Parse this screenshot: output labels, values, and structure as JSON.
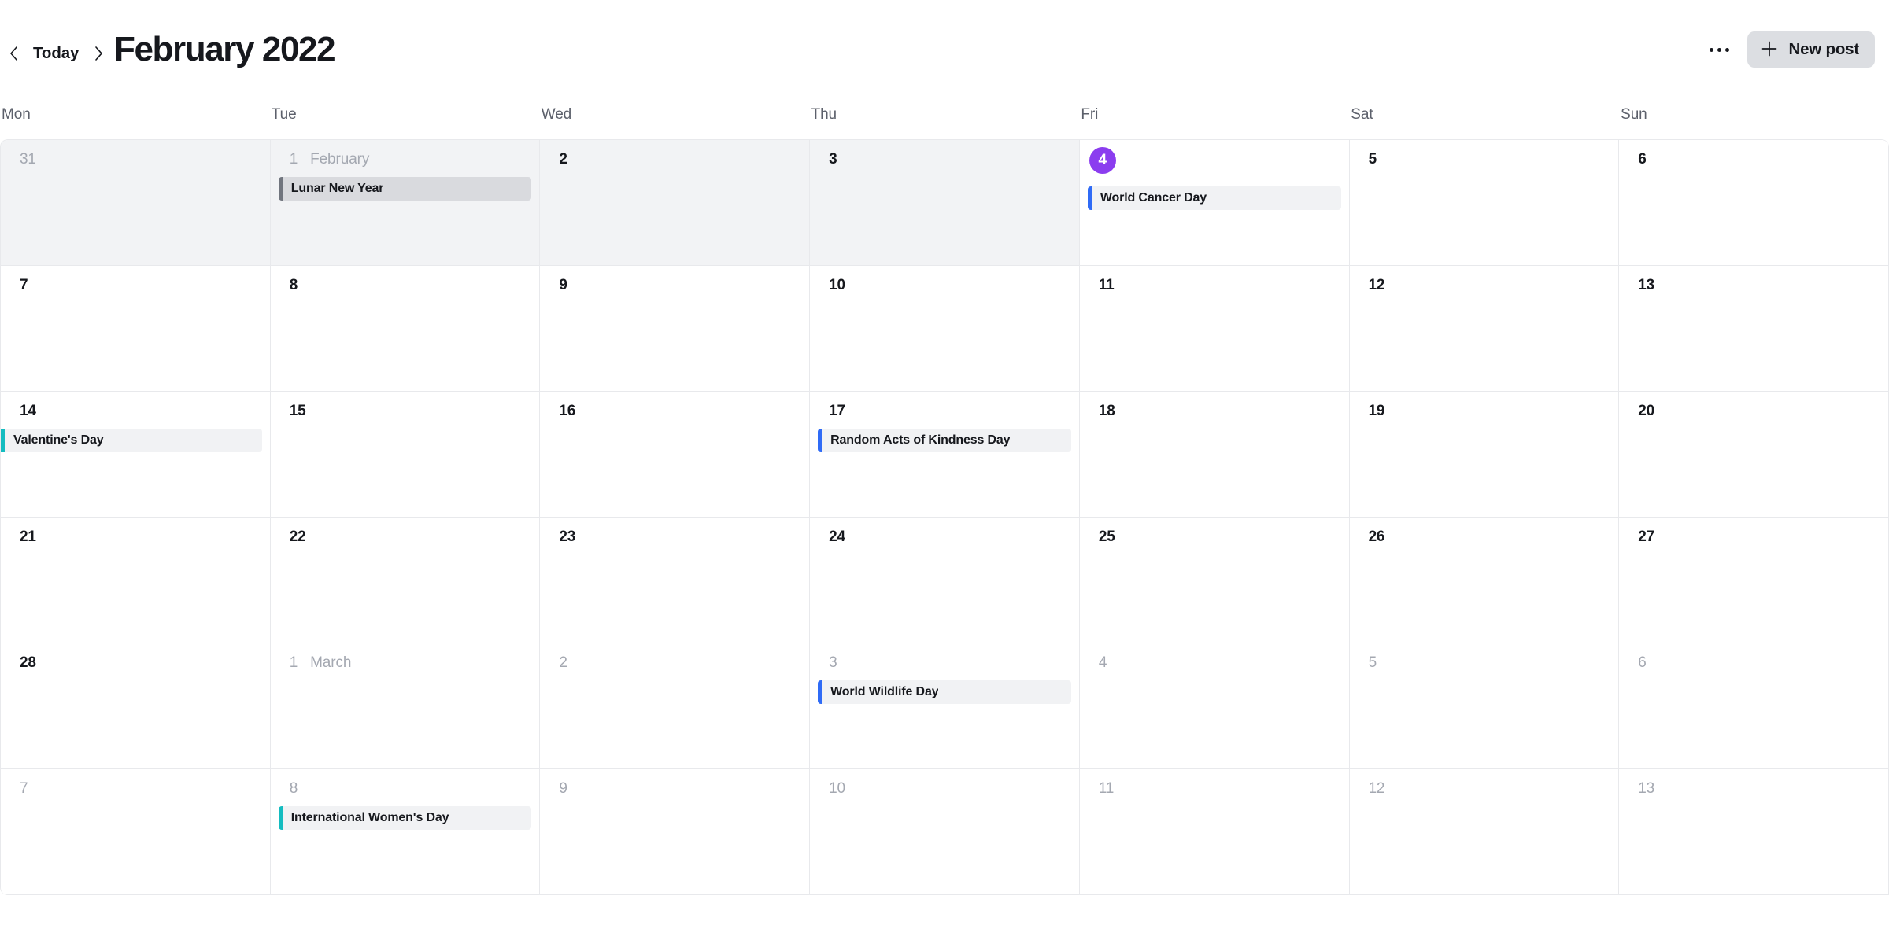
{
  "header": {
    "prev_icon": "chevron-left-icon",
    "next_icon": "chevron-right-icon",
    "today_label": "Today",
    "title": "February 2022",
    "more_icon": "ellipsis-icon",
    "new_post_label": "New post",
    "new_post_icon": "plus-icon"
  },
  "weekdays": [
    "Mon",
    "Tue",
    "Wed",
    "Thu",
    "Fri",
    "Sat",
    "Sun"
  ],
  "colors": {
    "today_badge": "#8b3def",
    "event_blue": "#2f6bf6",
    "event_teal": "#14bcc0",
    "event_gray": "#71757e",
    "chip_background": "#f1f2f4",
    "dim_cell_background": "#f2f3f5",
    "grid_line": "#e8e9ec",
    "button_background": "#dcdee2"
  },
  "weeks": [
    {
      "days": [
        {
          "num": "31",
          "other_month": true,
          "dim": true,
          "events": []
        },
        {
          "num": "1",
          "month_label": "February",
          "other_month": true,
          "dim": true,
          "events": [
            {
              "title": "Lunar New Year",
              "color": "#71757e"
            }
          ]
        },
        {
          "num": "2",
          "other_month": false,
          "dim": true,
          "events": []
        },
        {
          "num": "3",
          "other_month": false,
          "dim": true,
          "events": []
        },
        {
          "num": "4",
          "other_month": false,
          "today": true,
          "events": [
            {
              "title": "World Cancer Day",
              "color": "#2f6bf6"
            }
          ]
        },
        {
          "num": "5",
          "other_month": false,
          "events": []
        },
        {
          "num": "6",
          "other_month": false,
          "events": []
        }
      ]
    },
    {
      "days": [
        {
          "num": "7",
          "events": []
        },
        {
          "num": "8",
          "events": []
        },
        {
          "num": "9",
          "events": []
        },
        {
          "num": "10",
          "events": []
        },
        {
          "num": "11",
          "events": []
        },
        {
          "num": "12",
          "events": []
        },
        {
          "num": "13",
          "events": []
        }
      ]
    },
    {
      "days": [
        {
          "num": "14",
          "events": [
            {
              "title": "Valentine's Day",
              "color": "#14bcc0",
              "flush_left": true
            }
          ]
        },
        {
          "num": "15",
          "events": []
        },
        {
          "num": "16",
          "events": []
        },
        {
          "num": "17",
          "events": [
            {
              "title": "Random Acts of Kindness Day",
              "color": "#2f6bf6"
            }
          ]
        },
        {
          "num": "18",
          "events": []
        },
        {
          "num": "19",
          "events": []
        },
        {
          "num": "20",
          "events": []
        }
      ]
    },
    {
      "days": [
        {
          "num": "21",
          "events": []
        },
        {
          "num": "22",
          "events": []
        },
        {
          "num": "23",
          "events": []
        },
        {
          "num": "24",
          "events": []
        },
        {
          "num": "25",
          "events": []
        },
        {
          "num": "26",
          "events": []
        },
        {
          "num": "27",
          "events": []
        }
      ]
    },
    {
      "days": [
        {
          "num": "28",
          "events": []
        },
        {
          "num": "1",
          "month_label": "March",
          "other_month": true,
          "events": []
        },
        {
          "num": "2",
          "other_month": true,
          "events": []
        },
        {
          "num": "3",
          "other_month": true,
          "events": [
            {
              "title": "World Wildlife Day",
              "color": "#2f6bf6"
            }
          ]
        },
        {
          "num": "4",
          "other_month": true,
          "events": []
        },
        {
          "num": "5",
          "other_month": true,
          "events": []
        },
        {
          "num": "6",
          "other_month": true,
          "events": []
        }
      ]
    },
    {
      "days": [
        {
          "num": "7",
          "other_month": true,
          "events": []
        },
        {
          "num": "8",
          "other_month": true,
          "events": [
            {
              "title": "International Women's Day",
              "color": "#14bcc0"
            }
          ]
        },
        {
          "num": "9",
          "other_month": true,
          "events": []
        },
        {
          "num": "10",
          "other_month": true,
          "events": []
        },
        {
          "num": "11",
          "other_month": true,
          "events": []
        },
        {
          "num": "12",
          "other_month": true,
          "events": []
        },
        {
          "num": "13",
          "other_month": true,
          "events": []
        }
      ]
    }
  ]
}
